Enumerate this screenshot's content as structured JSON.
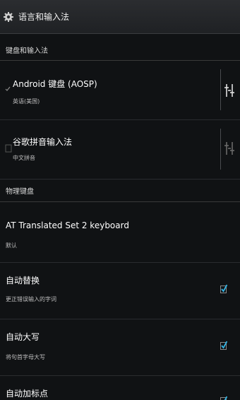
{
  "actionbar": {
    "title": "语言和输入法",
    "icon": "settings-gear-icon"
  },
  "keyboard_section": {
    "header": "键盘和输入法",
    "items": [
      {
        "title": "Android 键盘 (AOSP)",
        "subtitle": "英语(美国)",
        "enabled": true
      },
      {
        "title": "谷歌拼音输入法",
        "subtitle": "中文拼音",
        "enabled": false
      }
    ]
  },
  "physical_section": {
    "header": "物理键盘",
    "keyboard": {
      "title": "AT Translated Set 2 keyboard",
      "subtitle": "默认"
    },
    "options": [
      {
        "title": "自动替换",
        "subtitle": "更正错误输入的字词",
        "checked": true
      },
      {
        "title": "自动大写",
        "subtitle": "将句首字母大写",
        "checked": true
      },
      {
        "title": "自动加标点",
        "subtitle": "",
        "checked": true
      }
    ]
  },
  "colors": {
    "accent": "#33b5e5",
    "background": "#101214"
  }
}
